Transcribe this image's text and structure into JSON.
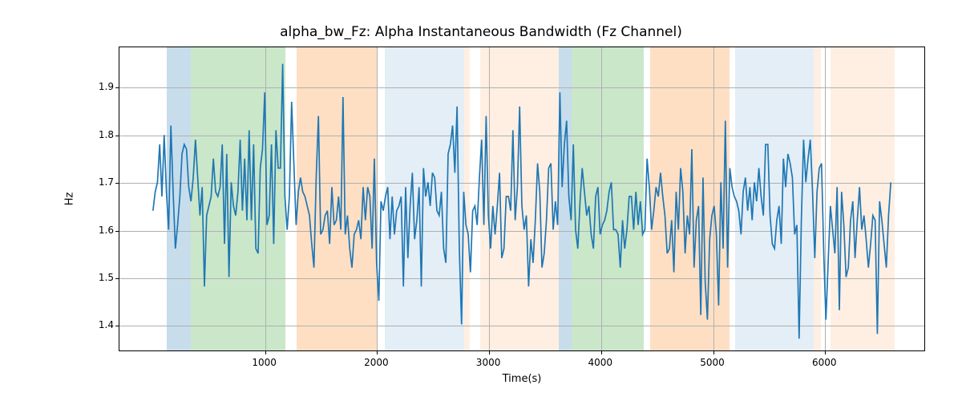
{
  "chart_data": {
    "type": "line",
    "title": "alpha_bw_Fz: Alpha Instantaneous Bandwidth (Fz Channel)",
    "xlabel": "Time(s)",
    "ylabel": "Hz",
    "xlim": [
      -300,
      6900
    ],
    "ylim": [
      1.345,
      1.985
    ],
    "xticks": [
      1000,
      2000,
      3000,
      4000,
      5000,
      6000
    ],
    "yticks": [
      1.4,
      1.5,
      1.6,
      1.7,
      1.8,
      1.9
    ],
    "bands": [
      {
        "x0": 120,
        "x1": 340,
        "color": "blue"
      },
      {
        "x0": 340,
        "x1": 1180,
        "color": "green"
      },
      {
        "x0": 1280,
        "x1": 2000,
        "color": "orange"
      },
      {
        "x0": 2070,
        "x1": 2780,
        "color": "lblue"
      },
      {
        "x0": 2780,
        "x1": 2830,
        "color": "lorange"
      },
      {
        "x0": 2920,
        "x1": 3620,
        "color": "lorange"
      },
      {
        "x0": 3620,
        "x1": 3740,
        "color": "blue"
      },
      {
        "x0": 3740,
        "x1": 4380,
        "color": "green"
      },
      {
        "x0": 4440,
        "x1": 5150,
        "color": "orange"
      },
      {
        "x0": 5200,
        "x1": 5900,
        "color": "lblue"
      },
      {
        "x0": 5900,
        "x1": 5960,
        "color": "lorange"
      },
      {
        "x0": 6050,
        "x1": 6620,
        "color": "lorange"
      }
    ],
    "series": [
      {
        "name": "alpha_bw_Fz",
        "color": "#1f77b4",
        "x_step": 20,
        "x_start": 0,
        "values": [
          1.64,
          1.68,
          1.7,
          1.78,
          1.67,
          1.8,
          1.68,
          1.6,
          1.82,
          1.68,
          1.56,
          1.61,
          1.67,
          1.76,
          1.78,
          1.77,
          1.69,
          1.66,
          1.71,
          1.79,
          1.71,
          1.63,
          1.69,
          1.48,
          1.63,
          1.65,
          1.67,
          1.75,
          1.68,
          1.67,
          1.69,
          1.78,
          1.57,
          1.76,
          1.5,
          1.7,
          1.65,
          1.63,
          1.68,
          1.79,
          1.64,
          1.75,
          1.62,
          1.81,
          1.62,
          1.78,
          1.56,
          1.55,
          1.73,
          1.77,
          1.89,
          1.61,
          1.63,
          1.78,
          1.57,
          1.81,
          1.73,
          1.73,
          1.95,
          1.67,
          1.6,
          1.67,
          1.87,
          1.74,
          1.61,
          1.68,
          1.71,
          1.68,
          1.67,
          1.65,
          1.63,
          1.57,
          1.52,
          1.71,
          1.84,
          1.59,
          1.6,
          1.63,
          1.64,
          1.57,
          1.69,
          1.61,
          1.62,
          1.67,
          1.6,
          1.88,
          1.59,
          1.63,
          1.56,
          1.52,
          1.59,
          1.6,
          1.62,
          1.58,
          1.69,
          1.62,
          1.69,
          1.67,
          1.56,
          1.75,
          1.53,
          1.45,
          1.66,
          1.64,
          1.67,
          1.69,
          1.58,
          1.67,
          1.59,
          1.64,
          1.65,
          1.67,
          1.48,
          1.69,
          1.54,
          1.65,
          1.72,
          1.58,
          1.62,
          1.69,
          1.48,
          1.73,
          1.67,
          1.7,
          1.65,
          1.72,
          1.71,
          1.64,
          1.63,
          1.68,
          1.56,
          1.53,
          1.76,
          1.78,
          1.82,
          1.72,
          1.86,
          1.56,
          1.4,
          1.68,
          1.61,
          1.59,
          1.51,
          1.64,
          1.65,
          1.61,
          1.71,
          1.79,
          1.61,
          1.84,
          1.63,
          1.56,
          1.65,
          1.59,
          1.65,
          1.72,
          1.54,
          1.56,
          1.67,
          1.67,
          1.64,
          1.81,
          1.62,
          1.69,
          1.86,
          1.65,
          1.6,
          1.63,
          1.48,
          1.58,
          1.53,
          1.62,
          1.74,
          1.68,
          1.52,
          1.55,
          1.62,
          1.73,
          1.74,
          1.6,
          1.66,
          1.61,
          1.89,
          1.69,
          1.78,
          1.83,
          1.67,
          1.62,
          1.78,
          1.6,
          1.56,
          1.66,
          1.73,
          1.68,
          1.63,
          1.65,
          1.59,
          1.56,
          1.67,
          1.69,
          1.59,
          1.61,
          1.62,
          1.64,
          1.68,
          1.7,
          1.6,
          1.6,
          1.59,
          1.52,
          1.62,
          1.56,
          1.6,
          1.67,
          1.67,
          1.6,
          1.68,
          1.61,
          1.66,
          1.59,
          1.6,
          1.75,
          1.69,
          1.6,
          1.64,
          1.69,
          1.67,
          1.72,
          1.67,
          1.63,
          1.55,
          1.56,
          1.62,
          1.51,
          1.68,
          1.6,
          1.73,
          1.68,
          1.55,
          1.63,
          1.59,
          1.77,
          1.52,
          1.62,
          1.65,
          1.42,
          1.71,
          1.49,
          1.41,
          1.58,
          1.63,
          1.65,
          1.59,
          1.44,
          1.7,
          1.56,
          1.83,
          1.52,
          1.73,
          1.69,
          1.67,
          1.66,
          1.64,
          1.59,
          1.68,
          1.71,
          1.64,
          1.69,
          1.62,
          1.7,
          1.66,
          1.73,
          1.67,
          1.63,
          1.78,
          1.78,
          1.63,
          1.57,
          1.56,
          1.62,
          1.65,
          1.57,
          1.75,
          1.69,
          1.76,
          1.74,
          1.71,
          1.59,
          1.61,
          1.37,
          1.62,
          1.79,
          1.7,
          1.75,
          1.79,
          1.68,
          1.54,
          1.68,
          1.73,
          1.74,
          1.55,
          1.41,
          1.53,
          1.65,
          1.6,
          1.55,
          1.69,
          1.43,
          1.68,
          1.61,
          1.5,
          1.52,
          1.62,
          1.66,
          1.54,
          1.62,
          1.69,
          1.6,
          1.63,
          1.58,
          1.52,
          1.57,
          1.63,
          1.62,
          1.38,
          1.66,
          1.62,
          1.57,
          1.52,
          1.63,
          1.7
        ]
      }
    ]
  }
}
